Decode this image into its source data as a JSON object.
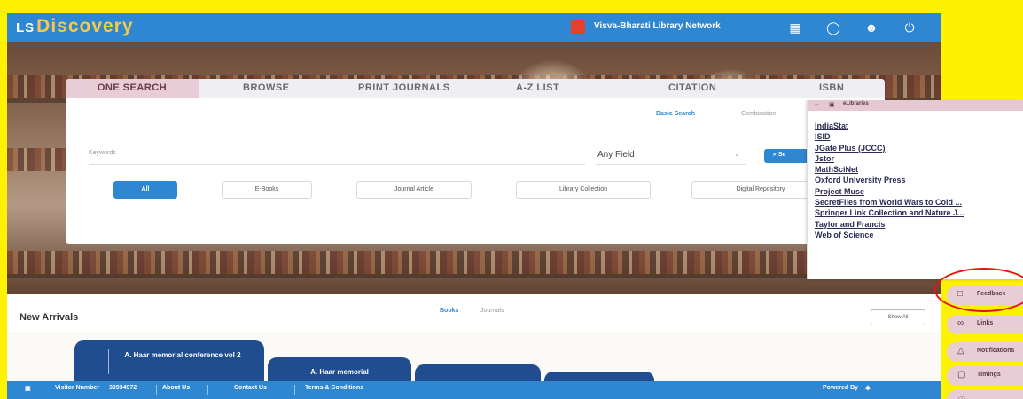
{
  "header": {
    "logo_prefix": "LS",
    "logo_main": "Discovery",
    "network": "Visva-Bharati Library Network",
    "icons": [
      "grid-icon",
      "ebook-icon",
      "user-icon",
      "power-icon"
    ]
  },
  "search": {
    "tabs": [
      "ONE SEARCH",
      "BROWSE",
      "PRINT JOURNALS",
      "A-Z LIST",
      "CITATION",
      "ISBN"
    ],
    "active_tab": "ONE SEARCH",
    "modes": {
      "basic": "Basic Search",
      "combination": "Combination"
    },
    "keywords_label": "Keywords",
    "field_value": "Any Field",
    "search_button": "Se",
    "filters": [
      "All",
      "E-Books",
      "Journal Article",
      "Library Collection",
      "Digital Repository"
    ],
    "active_filter": "All"
  },
  "elibraries": {
    "title": "eLibraries",
    "items": [
      "IndiaStat",
      "ISID",
      "JGate Plus (JCCC)",
      "Jstor",
      "MathSciNet",
      "Oxford University Press",
      "Project Muse",
      "SecretFiles from World Wars to Cold ...",
      "Springer Link Collection and Nature J...",
      "Taylor and Francis",
      "Web of Science"
    ]
  },
  "arrivals": {
    "title": "New Arrivals",
    "tabs": [
      "Books",
      "Journals"
    ],
    "active_tab": "Books",
    "view_all": "Show All",
    "books": [
      "A. Haar memorial conference vol 2",
      "A. Haar memorial",
      "",
      ""
    ]
  },
  "side_buttons": [
    {
      "icon": "feedback-icon",
      "label": "Feedback"
    },
    {
      "icon": "links-icon",
      "label": "Links"
    },
    {
      "icon": "bell-icon",
      "label": "Notifications"
    },
    {
      "icon": "message-icon",
      "label": "Timings"
    },
    {
      "icon": "info-icon",
      "label": ""
    }
  ],
  "footer": {
    "visitor_label": "Visitor Number",
    "visitor_number": "39934972",
    "about": "About Us",
    "contact": "Contact Us",
    "terms": "Terms & Conditions",
    "powered": "Powered By"
  },
  "colors": {
    "brand_blue": "#2f86d1",
    "accent_pink": "#e8ccd6",
    "highlight_ring": "#e01818",
    "background": "#fff200"
  }
}
